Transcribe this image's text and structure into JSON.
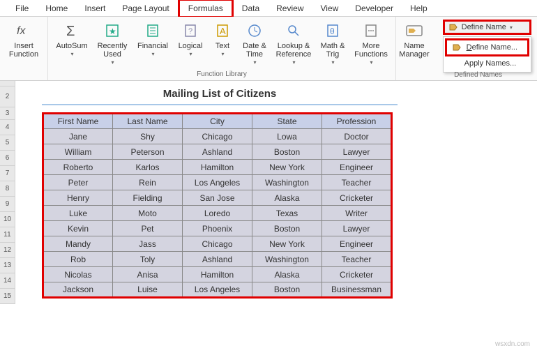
{
  "tabs": [
    "File",
    "Home",
    "Insert",
    "Page Layout",
    "Formulas",
    "Data",
    "Review",
    "View",
    "Developer",
    "Help"
  ],
  "active_tab": "Formulas",
  "ribbon": {
    "insert_function": "Insert\nFunction",
    "autosum": "AutoSum",
    "recently_used": "Recently\nUsed",
    "financial": "Financial",
    "logical": "Logical",
    "text": "Text",
    "date_time": "Date &\nTime",
    "lookup_ref": "Lookup &\nReference",
    "math_trig": "Math &\nTrig",
    "more_functions": "More\nFunctions",
    "name_manager": "Name\nManager",
    "function_library_label": "Function Library",
    "defined_names_label": "Defined Names"
  },
  "define_name": {
    "button": "Define Name",
    "menu_define": "Define Name...",
    "menu_apply": "Apply Names..."
  },
  "sheet": {
    "title": "Mailing List of Citizens",
    "row_numbers": [
      "2",
      "3",
      "4",
      "5",
      "6",
      "7",
      "8",
      "9",
      "10",
      "11",
      "12",
      "13",
      "14",
      "15"
    ],
    "headers": [
      "First Name",
      "Last Name",
      "City",
      "State",
      "Profession"
    ],
    "rows": [
      [
        "Jane",
        "Shy",
        "Chicago",
        "Lowa",
        "Doctor"
      ],
      [
        "William",
        "Peterson",
        "Ashland",
        "Boston",
        "Lawyer"
      ],
      [
        "Roberto",
        "Karlos",
        "Hamilton",
        "New York",
        "Engineer"
      ],
      [
        "Peter",
        "Rein",
        "Los Angeles",
        "Washington",
        "Teacher"
      ],
      [
        "Henry",
        "Fielding",
        "San Jose",
        "Alaska",
        "Cricketer"
      ],
      [
        "Luke",
        "Moto",
        "Loredo",
        "Texas",
        "Writer"
      ],
      [
        "Kevin",
        "Pet",
        "Phoenix",
        "Boston",
        "Lawyer"
      ],
      [
        "Mandy",
        "Jass",
        "Chicago",
        "New York",
        "Engineer"
      ],
      [
        "Rob",
        "Toly",
        "Ashland",
        "Washington",
        "Teacher"
      ],
      [
        "Nicolas",
        "Anisa",
        "Hamilton",
        "Alaska",
        "Cricketer"
      ],
      [
        "Jackson",
        "Luise",
        "Los Angeles",
        "Boston",
        "Businessman"
      ]
    ]
  },
  "watermark": "wsxdn.com"
}
